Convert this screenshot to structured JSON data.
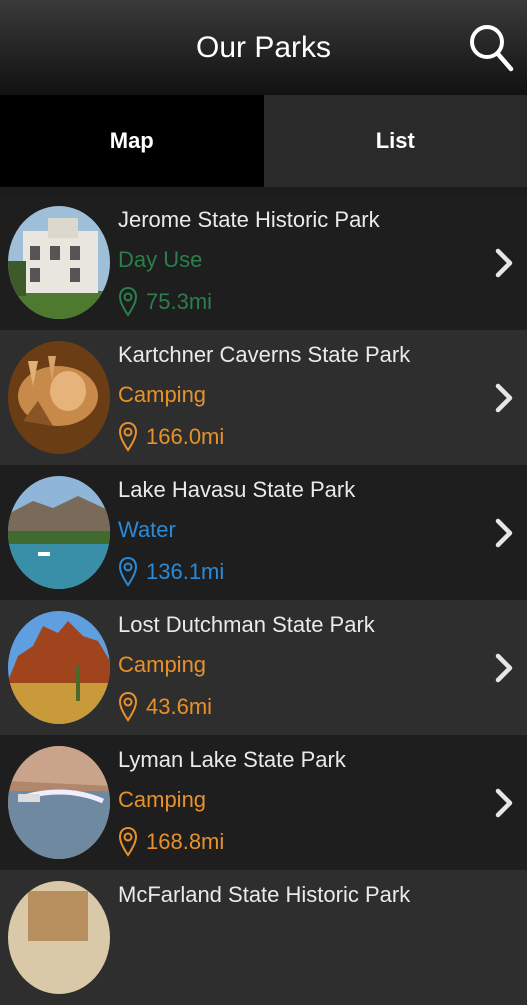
{
  "header": {
    "title": "Our Parks",
    "search_icon": "search-icon"
  },
  "tabs": [
    {
      "label": "Map",
      "active": true
    },
    {
      "label": "List",
      "active": false
    }
  ],
  "colors": {
    "day_use": "#2a7f4a",
    "camping": "#e8912a",
    "water": "#2a8ad8"
  },
  "parks": [
    {
      "name": "Jerome State Historic Park",
      "category": "Day Use",
      "distance": "75.3mi",
      "color": "#2a7f4a"
    },
    {
      "name": "Kartchner Caverns State Park",
      "category": "Camping",
      "distance": "166.0mi",
      "color": "#e8912a"
    },
    {
      "name": "Lake Havasu State Park",
      "category": "Water",
      "distance": "136.1mi",
      "color": "#2a8ad8"
    },
    {
      "name": "Lost Dutchman State Park",
      "category": "Camping",
      "distance": "43.6mi",
      "color": "#e8912a"
    },
    {
      "name": "Lyman Lake State Park",
      "category": "Camping",
      "distance": "168.8mi",
      "color": "#e8912a"
    },
    {
      "name": "McFarland State Historic Park",
      "category": "",
      "distance": "",
      "color": "#e8912a"
    }
  ]
}
